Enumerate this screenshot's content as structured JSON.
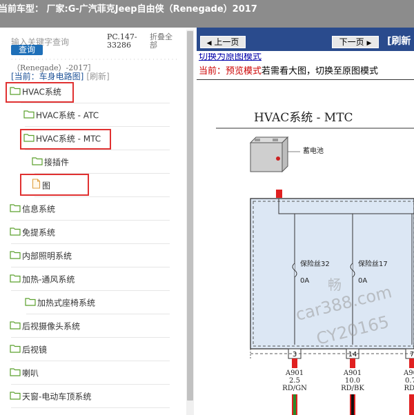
{
  "top": {
    "text": "当前车型： 厂家:G-广汽菲克Jeep自由侠（Renegade）2017"
  },
  "search": {
    "placeholder": "输入关键字查询",
    "button": "查询"
  },
  "pc_code": "PC.147-33286",
  "fold_all": "折叠全部",
  "dots": "··························································",
  "model_line": "（Renegade）-2017］",
  "current": {
    "label": "[当前：车身电路图]",
    "refresh": "[刷新]"
  },
  "tree": [
    {
      "label": "HVAC系统",
      "icon": "folder-icon",
      "highlight": true
    },
    {
      "label": "HVAC系统 - ATC",
      "icon": "folder-icon",
      "highlight": false
    },
    {
      "label": "HVAC系统 - MTC",
      "icon": "folder-icon",
      "highlight": true
    },
    {
      "label": "接插件",
      "icon": "folder-icon",
      "highlight": false
    },
    {
      "label": "图",
      "icon": "file-icon",
      "highlight": true
    },
    {
      "label": "信息系统",
      "icon": "folder-icon",
      "highlight": false
    },
    {
      "label": "免提系统",
      "icon": "folder-icon",
      "highlight": false
    },
    {
      "label": "内部照明系统",
      "icon": "folder-icon",
      "highlight": false
    },
    {
      "label": "加热-通风系统",
      "icon": "folder-icon",
      "highlight": false
    },
    {
      "label": "加热式座椅系统",
      "icon": "folder-icon",
      "highlight": false
    },
    {
      "label": "后视摄像头系统",
      "icon": "folder-icon",
      "highlight": false
    },
    {
      "label": "后视镜",
      "icon": "folder-icon",
      "highlight": false
    },
    {
      "label": "喇叭",
      "icon": "folder-icon",
      "highlight": false
    },
    {
      "label": "天窗-电动车顶系统",
      "icon": "folder-icon",
      "highlight": false
    }
  ],
  "viewer": {
    "prev": "上一页",
    "next": "下一页",
    "refresh": "[刷新",
    "toggle_link": "切换为原图模式",
    "mode_current": "当前：预览模式",
    "mode_hint": "若需看大图，切换至原图模式"
  },
  "diagram": {
    "title": "HVAC系统 - MTC",
    "battery": "蓄电池",
    "fuses": [
      {
        "name": "保险丝32",
        "rating": "0A"
      },
      {
        "name": "保险丝17",
        "rating": "0A"
      }
    ],
    "pins": [
      "3",
      "14",
      "7"
    ],
    "wires": [
      {
        "id": "A901",
        "gauge": "2.5",
        "color": "RD/GN"
      },
      {
        "id": "A901",
        "gauge": "10.0",
        "color": "RD/BK"
      },
      {
        "id": "A90",
        "gauge": "0.7",
        "color": "RD/"
      }
    ],
    "watermarks": [
      "畅",
      "car388.com",
      "CY20165"
    ],
    "colors": {
      "box_fill": "#dce7f4",
      "wire_red": "#e02020",
      "wire_stripe_green": "#2a8a2a"
    }
  }
}
